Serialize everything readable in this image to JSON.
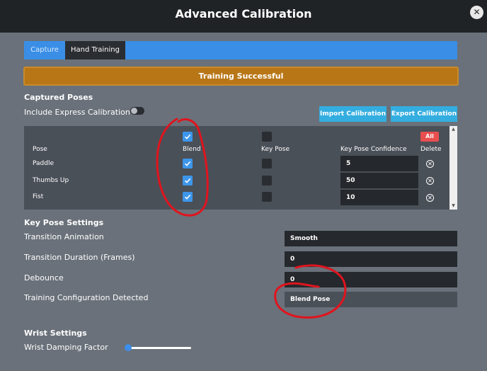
{
  "window": {
    "title": "Advanced Calibration",
    "close_symbol": "✕"
  },
  "tabs": [
    {
      "label": "Capture",
      "active": false
    },
    {
      "label": "Hand Training",
      "active": true
    }
  ],
  "banner": {
    "text": "Training Successful"
  },
  "captured_poses": {
    "title": "Captured Poses",
    "include_express_label": "Include Express Calibration",
    "include_express_on": false,
    "import_label": "Import Calibration",
    "export_label": "Export Calibration",
    "columns": {
      "pose": "Pose",
      "blend": "Blend",
      "key_pose": "Key Pose",
      "confidence": "Key Pose Confidence",
      "delete": "Delete"
    },
    "header_blend_checked": true,
    "header_key_pose_checked": false,
    "all_label": "All",
    "rows": [
      {
        "pose": "Paddle",
        "blend": true,
        "key_pose": false,
        "confidence": "5"
      },
      {
        "pose": "Thumbs Up",
        "blend": true,
        "key_pose": false,
        "confidence": "50"
      },
      {
        "pose": "Fist",
        "blend": true,
        "key_pose": false,
        "confidence": "10"
      }
    ]
  },
  "key_pose_settings": {
    "title": "Key Pose Settings",
    "transition_animation": {
      "label": "Transition Animation",
      "value": "Smooth"
    },
    "transition_duration": {
      "label": "Transition Duration (Frames)",
      "value": "0"
    },
    "debounce": {
      "label": "Debounce",
      "value": "0"
    },
    "training_config": {
      "label": "Training Configuration Detected",
      "value": "Blend Pose"
    }
  },
  "wrist_settings": {
    "title": "Wrist Settings",
    "damping_label": "Wrist Damping Factor",
    "damping_value": 0.0
  },
  "colors": {
    "accent": "#3a8ee6",
    "banner": "#b87617",
    "danger": "#e94f4f",
    "annotation": "#e0141e"
  }
}
